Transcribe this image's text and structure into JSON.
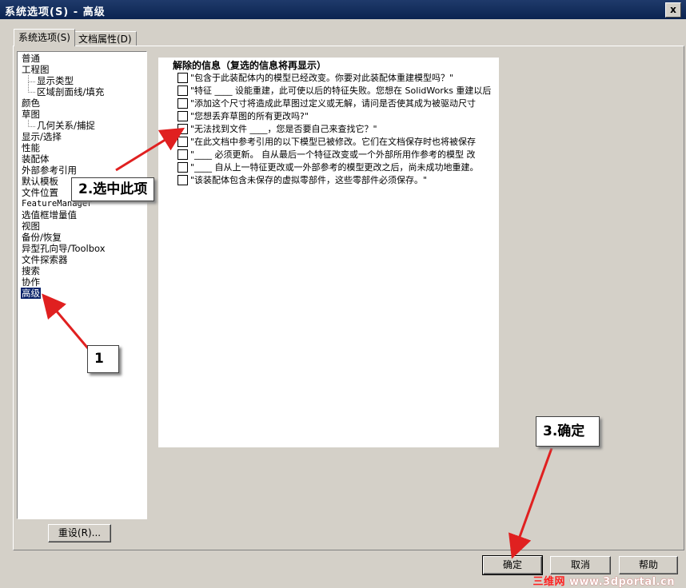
{
  "window": {
    "title": "系统选项(S) - 高级",
    "close_label": "x"
  },
  "tabs": [
    {
      "label": "系统选项(S)"
    },
    {
      "label": "文档属性(D)"
    }
  ],
  "tree": {
    "items": [
      {
        "label": "普通"
      },
      {
        "label": "工程图"
      },
      {
        "label": "显示类型"
      },
      {
        "label": "区域剖面线/填充"
      },
      {
        "label": "颜色"
      },
      {
        "label": "草图"
      },
      {
        "label": "几何关系/捕捉"
      },
      {
        "label": "显示/选择"
      },
      {
        "label": "性能"
      },
      {
        "label": "装配体"
      },
      {
        "label": "外部参考引用"
      },
      {
        "label": "默认模板"
      },
      {
        "label": "文件位置"
      },
      {
        "label": "FeatureManager"
      },
      {
        "label": "选值框增量值"
      },
      {
        "label": "视图"
      },
      {
        "label": "备份/恢复"
      },
      {
        "label": "异型孔向导/Toolbox"
      },
      {
        "label": "文件探索器"
      },
      {
        "label": "搜索"
      },
      {
        "label": "协作"
      },
      {
        "label": "高级"
      }
    ]
  },
  "content": {
    "heading": "解除的信息（复选的信息将再显示）",
    "messages": [
      {
        "text": "\"包含于此装配体内的模型已经改变。你要对此装配体重建模型吗？\"",
        "checked": false
      },
      {
        "text": "\"特征 ____ 设能重建，此可使以后的特征失败。您想在 SolidWorks 重建以后",
        "checked": false
      },
      {
        "text": "\"添加这个尺寸将造成此草图过定义或无解，请问是否使其成为被驱动尺寸",
        "checked": false
      },
      {
        "text": "\"您想丢弃草图的所有更改吗?\"",
        "checked": false
      },
      {
        "text": "\"无法找到文件 ____，您是否要自己来查找它？\"",
        "checked": false
      },
      {
        "text": "\"在此文档中参考引用的以下模型已被修改。它们在文档保存时也将被保存",
        "checked": false
      },
      {
        "text": "\"____ 必须更新。 自从最后一个特征改变或一个外部所用作参考的模型 改",
        "checked": false
      },
      {
        "text": "\"____ 自从上一特征更改或一外部参考的模型更改之后，尚未成功地重建。",
        "checked": false
      },
      {
        "text": "\"该装配体包含未保存的虚拟零部件，这些零部件必须保存。\"",
        "checked": false
      }
    ]
  },
  "buttons": {
    "reset": "重设(R)...",
    "ok": "确定",
    "cancel": "取消",
    "help": "帮助"
  },
  "annotations": {
    "callout1": "1",
    "callout2": "2.选中此项",
    "callout3": "3.确定",
    "arrow_color": "#e02020"
  },
  "watermark": {
    "part1": "三维网",
    "part2": " www.3dportal.cn"
  }
}
